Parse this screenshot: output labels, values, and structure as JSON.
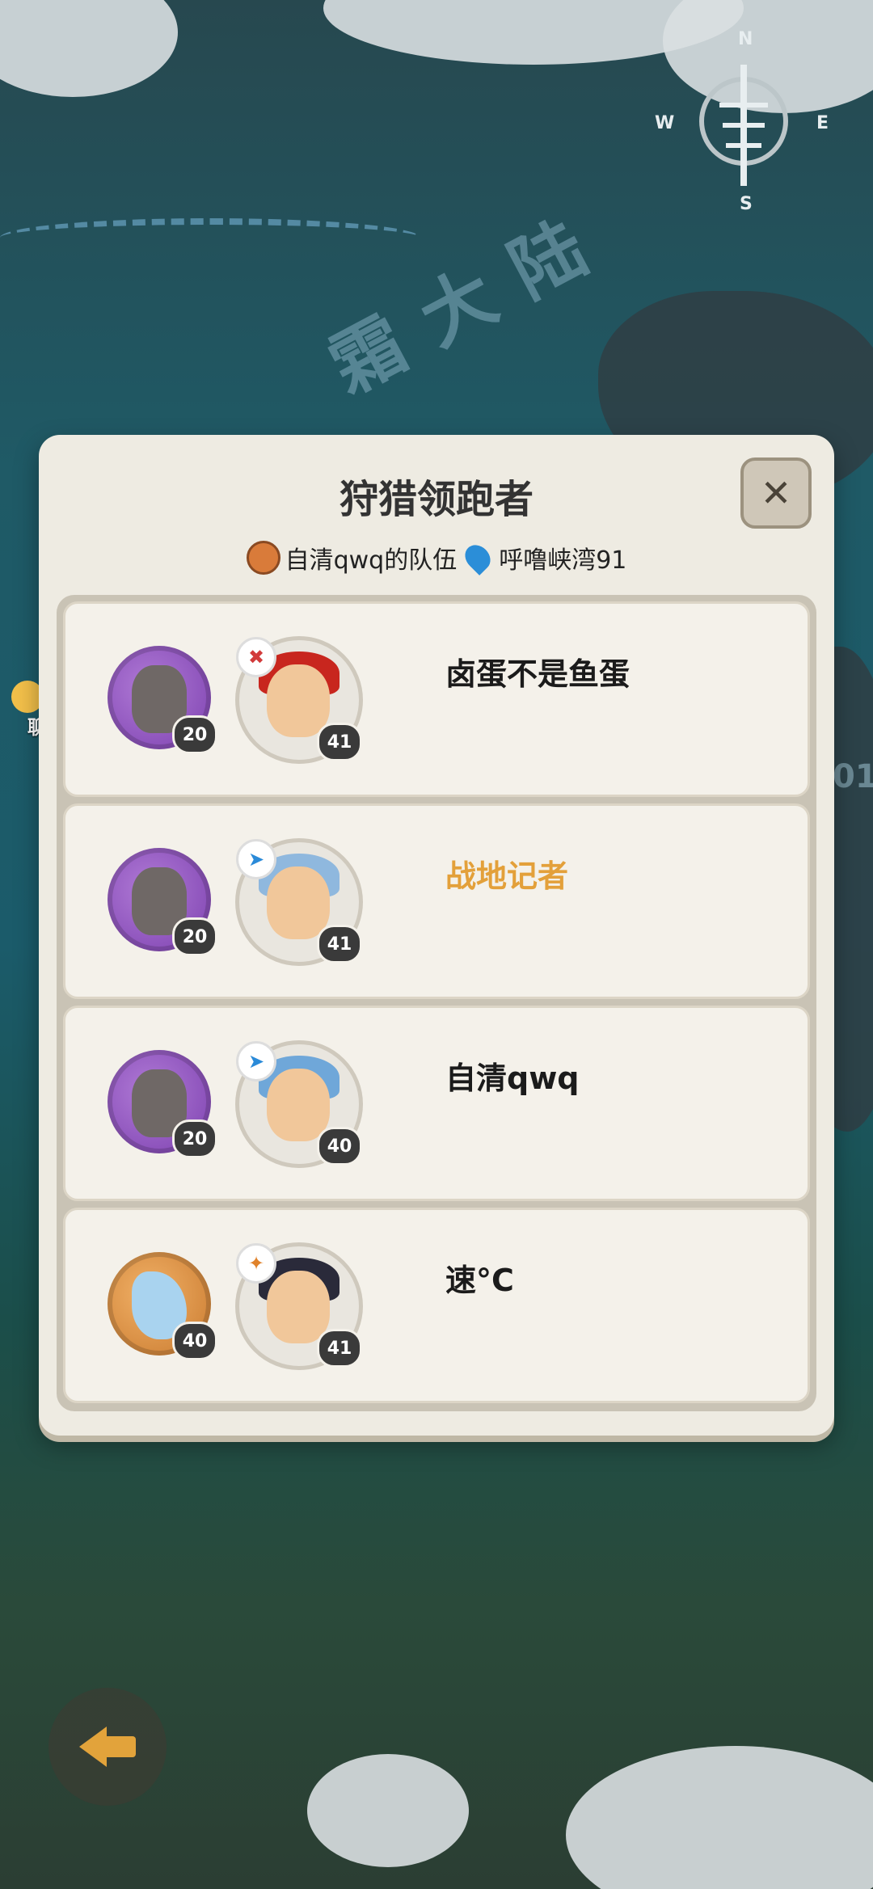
{
  "map": {
    "region_name": "霜大陆",
    "compass": {
      "n": "N",
      "s": "S",
      "w": "W",
      "e": "E"
    },
    "side_label": "01"
  },
  "modal": {
    "title": "狩猎领跑者",
    "team_name": "自清qwq的队伍",
    "location": "呼噜峡湾91",
    "close_icon": "close-icon"
  },
  "players": [
    {
      "name": "卤蛋不是鱼蛋",
      "pet_level": "20",
      "hero_level": "41",
      "pet_color": "purple",
      "class": "red",
      "highlight": false
    },
    {
      "name": "战地记者",
      "pet_level": "20",
      "hero_level": "41",
      "pet_color": "purple",
      "class": "blue",
      "highlight": true
    },
    {
      "name": "自清qwq",
      "pet_level": "20",
      "hero_level": "40",
      "pet_color": "purple",
      "class": "blue",
      "highlight": false
    },
    {
      "name": "速°C",
      "pet_level": "40",
      "hero_level": "41",
      "pet_color": "orange",
      "class": "orange",
      "highlight": false
    }
  ],
  "chat": {
    "label": "聊天"
  },
  "colors": {
    "highlight": "#e3a03a",
    "panel": "#eeebe2",
    "accent": "#e2a33b"
  }
}
